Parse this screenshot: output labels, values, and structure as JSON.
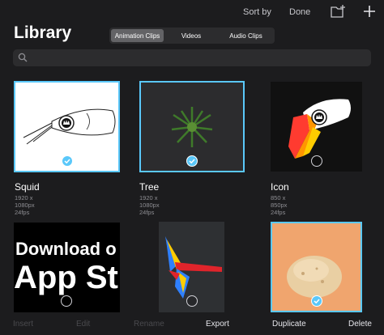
{
  "topbar": {
    "sort_label": "Sort by",
    "done_label": "Done"
  },
  "title": "Library",
  "tabs": [
    {
      "label": "Animation Clips",
      "selected": true
    },
    {
      "label": "Videos",
      "selected": false
    },
    {
      "label": "Audio Clips",
      "selected": false
    }
  ],
  "search": {
    "placeholder": "",
    "value": ""
  },
  "clips": [
    {
      "name": "Squid",
      "meta": "1920 x 1080px 24fps",
      "selected": true
    },
    {
      "name": "Tree",
      "meta": "1920 x 1080px 24fps",
      "selected": true
    },
    {
      "name": "Icon",
      "meta": "850 x 850px 24fps",
      "selected": false
    },
    {
      "thumb_text_1": "Download o",
      "thumb_text_2": "App St",
      "selected": false
    },
    {
      "selected": false
    },
    {
      "selected": true
    }
  ],
  "toolbar": {
    "insert": "Insert",
    "edit": "Edit",
    "rename": "Rename",
    "export": "Export",
    "duplicate": "Duplicate",
    "delete": "Delete"
  },
  "colors": {
    "accent": "#5ac8fa",
    "background": "#1c1c1e",
    "thumb_orange": "#f0a56e",
    "thumb_dark": "#2c2c2e"
  }
}
